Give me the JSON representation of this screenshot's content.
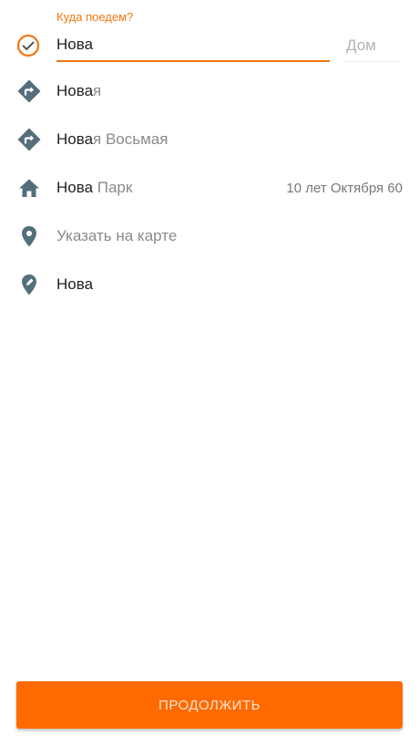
{
  "search": {
    "label": "Куда поедем?",
    "value": "Нова",
    "home_placeholder": "Дом"
  },
  "suggestions": [
    {
      "icon": "turn-right-icon",
      "match": "Нова",
      "rest": "я",
      "detail": ""
    },
    {
      "icon": "turn-right-icon",
      "match": "Нова",
      "rest": "я Восьмая",
      "detail": ""
    },
    {
      "icon": "home-icon",
      "match": "Нова",
      "rest": " Парк",
      "detail": "10 лет Октября 60"
    },
    {
      "icon": "location-pin-icon",
      "match": "",
      "rest": "Указать на карте",
      "detail": ""
    },
    {
      "icon": "edit-location-icon",
      "match": "Нова",
      "rest": "",
      "detail": ""
    }
  ],
  "continue_label": "ПРОДОЛЖИТЬ",
  "colors": {
    "accent": "#f07613",
    "button": "#ff6a00",
    "icon": "#546e7a"
  }
}
